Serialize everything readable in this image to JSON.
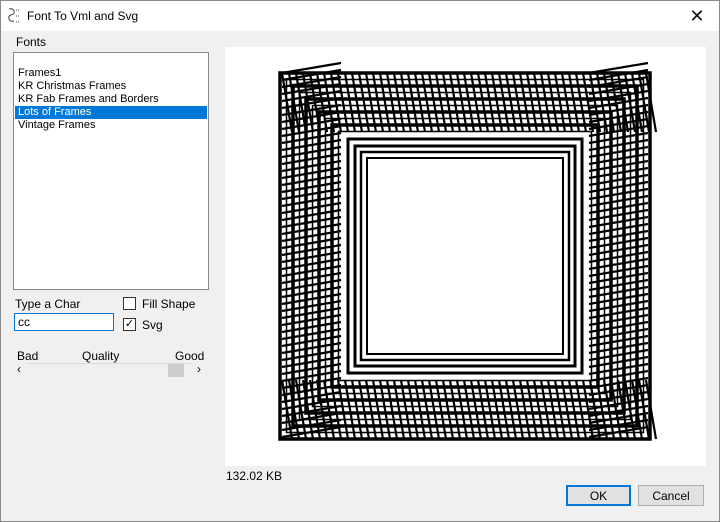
{
  "window": {
    "title": "Font To Vml  and Svg",
    "close_glyph": "✕"
  },
  "fonts": {
    "label": "Fonts",
    "items": [
      {
        "label": "Frames1",
        "selected": false
      },
      {
        "label": "KR Christmas Frames",
        "selected": false
      },
      {
        "label": "KR Fab Frames and Borders",
        "selected": false
      },
      {
        "label": "Lots of Frames",
        "selected": true
      },
      {
        "label": "Vintage Frames",
        "selected": false
      }
    ]
  },
  "char": {
    "label": "Type a Char",
    "value": "cc"
  },
  "options": {
    "fill_shape_label": "Fill Shape",
    "fill_shape_checked": false,
    "svg_label": "Svg",
    "svg_checked": true,
    "check_glyph": "✓"
  },
  "quality": {
    "bad_label": "Bad",
    "label": "Quality",
    "good_label": "Good",
    "left_arrow": "‹",
    "right_arrow": "›",
    "level": 0.95
  },
  "preview": {
    "size_text": "132.02 KB",
    "icon": "frame-glyph-preview"
  },
  "buttons": {
    "ok_label": "OK",
    "cancel_label": "Cancel"
  },
  "colors": {
    "selection": "#0078d7",
    "window_bg": "#f0f0f0",
    "default_border": "#0078d7"
  }
}
